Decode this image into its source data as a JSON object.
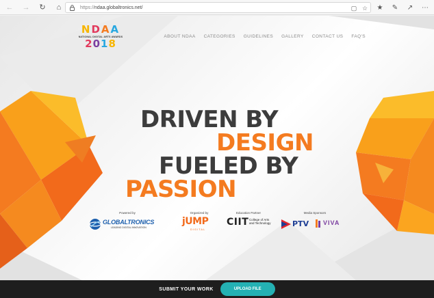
{
  "browser": {
    "url_scheme": "https://",
    "url_host": "ndaa.globaltronics.net/"
  },
  "logo": {
    "top": "NDAA",
    "subtitle": "NATIONAL DIGITAL ARTS AWARDS",
    "year": "2018"
  },
  "nav": {
    "items": [
      "ABOUT NDAA",
      "CATEGORIES",
      "GUIDELINES",
      "GALLERY",
      "CONTACT US",
      "FAQ'S"
    ]
  },
  "hero": {
    "line1": "DRIVEN BY",
    "line2": "DESIGN",
    "line3": "FUELED BY",
    "line4": "PASSION"
  },
  "sponsors": {
    "powered_label": "Powered by",
    "organized_label": "Organized by",
    "education_label": "Education Partner",
    "media_label": "Media Sponsors",
    "globaltronics_name": "GLOBALTRONICS",
    "globaltronics_tagline": "LEADING DIGITAL INNOVATION",
    "jump_name": "jUMP",
    "jump_sub": "DIGITAL",
    "ciit_name": "CIIT",
    "ciit_desc": "College of Arts and Technology",
    "ptv_name": "PTV",
    "viva_name": "VIVA"
  },
  "footer": {
    "submit_text": "SUBMIT YOUR WORK",
    "upload_label": "UPLOAD FILE"
  },
  "colors": {
    "accent_orange": "#f47b20",
    "teal_button": "#24b1b3",
    "footer_bg": "#1e1e1e"
  }
}
